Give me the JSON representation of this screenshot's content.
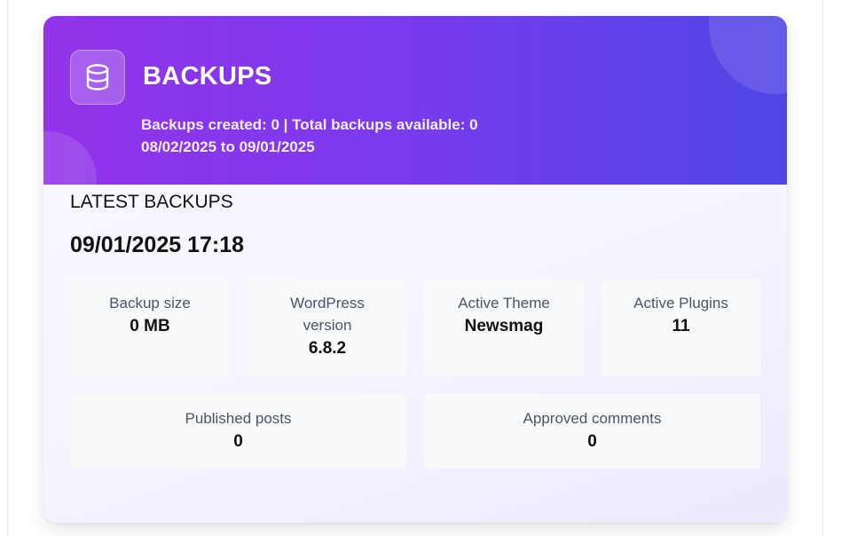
{
  "card": {
    "title": "BACKUPS",
    "icon": "database-icon",
    "summary_line": "Backups created: 0 | Total backups available: 0",
    "date_range": "08/02/2025 to 09/01/2025",
    "colors": {
      "header_start": "#9333ea",
      "header_end": "#4f46e5"
    }
  },
  "latest": {
    "label": "LATEST BACKUPS",
    "datetime": "09/01/2025 17:18"
  },
  "stats": {
    "backup_size": {
      "label": "Backup size",
      "value": "0 MB"
    },
    "wp_version": {
      "label": "WordPress version",
      "value": "6.8.2"
    },
    "active_theme": {
      "label": "Active Theme",
      "value": "Newsmag"
    },
    "active_plugins": {
      "label": "Active Plugins",
      "value": "11"
    },
    "published_posts": {
      "label": "Published posts",
      "value": "0"
    },
    "approved_comments": {
      "label": "Approved comments",
      "value": "0"
    }
  }
}
